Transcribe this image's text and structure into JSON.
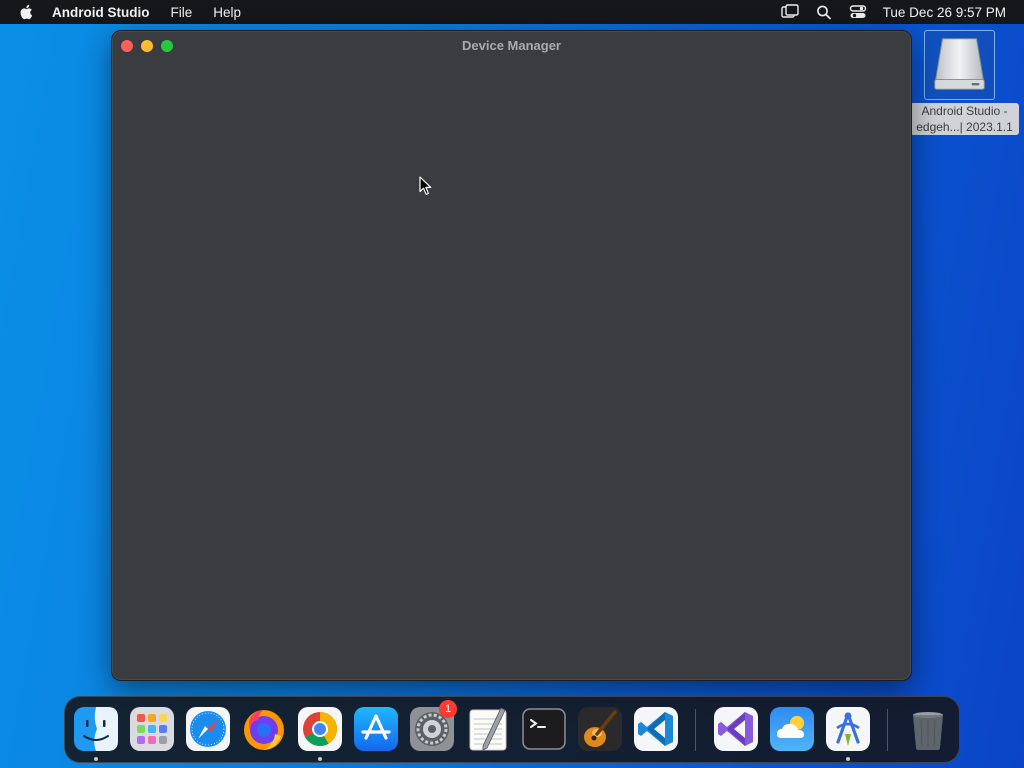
{
  "menubar": {
    "app_name": "Android Studio",
    "items": [
      "File",
      "Help"
    ],
    "clock": "Tue Dec 26  9:57 PM",
    "status_icons": [
      "screen-mirroring-icon",
      "spotlight-search-icon",
      "control-center-icon"
    ]
  },
  "window": {
    "title": "Device Manager"
  },
  "desktop": {
    "disk_label_line1": "Android Studio -",
    "disk_label_line2": "edgeh...| 2023.1.1"
  },
  "dock": {
    "apps": [
      {
        "name": "Finder",
        "icon": "finder-icon",
        "running": true
      },
      {
        "name": "Launchpad",
        "icon": "launchpad-icon",
        "running": false
      },
      {
        "name": "Safari",
        "icon": "safari-icon",
        "running": false
      },
      {
        "name": "Firefox",
        "icon": "firefox-icon",
        "running": false
      },
      {
        "name": "Chrome",
        "icon": "chrome-icon",
        "running": true
      },
      {
        "name": "App Store",
        "icon": "app-store-icon",
        "running": false
      },
      {
        "name": "System Settings",
        "icon": "system-settings-icon",
        "running": false,
        "badge": "1"
      },
      {
        "name": "TextEdit",
        "icon": "textedit-icon",
        "running": false
      },
      {
        "name": "Terminal",
        "icon": "terminal-icon",
        "running": false
      },
      {
        "name": "GarageBand",
        "icon": "garageband-icon",
        "running": false
      },
      {
        "name": "VS Code",
        "icon": "vscode-icon",
        "running": false
      },
      {
        "name": "Visual Studio",
        "icon": "visual-studio-icon",
        "running": false
      },
      {
        "name": "Weather",
        "icon": "weather-icon",
        "running": false
      },
      {
        "name": "Android Studio",
        "icon": "android-studio-icon",
        "running": true
      },
      {
        "name": "Trash",
        "icon": "trash-icon",
        "running": false
      }
    ]
  },
  "colors": {
    "window_bg": "#3b3c3f",
    "menubar_bg": "#16171b",
    "desktop_blue": "#0a6fdc"
  }
}
